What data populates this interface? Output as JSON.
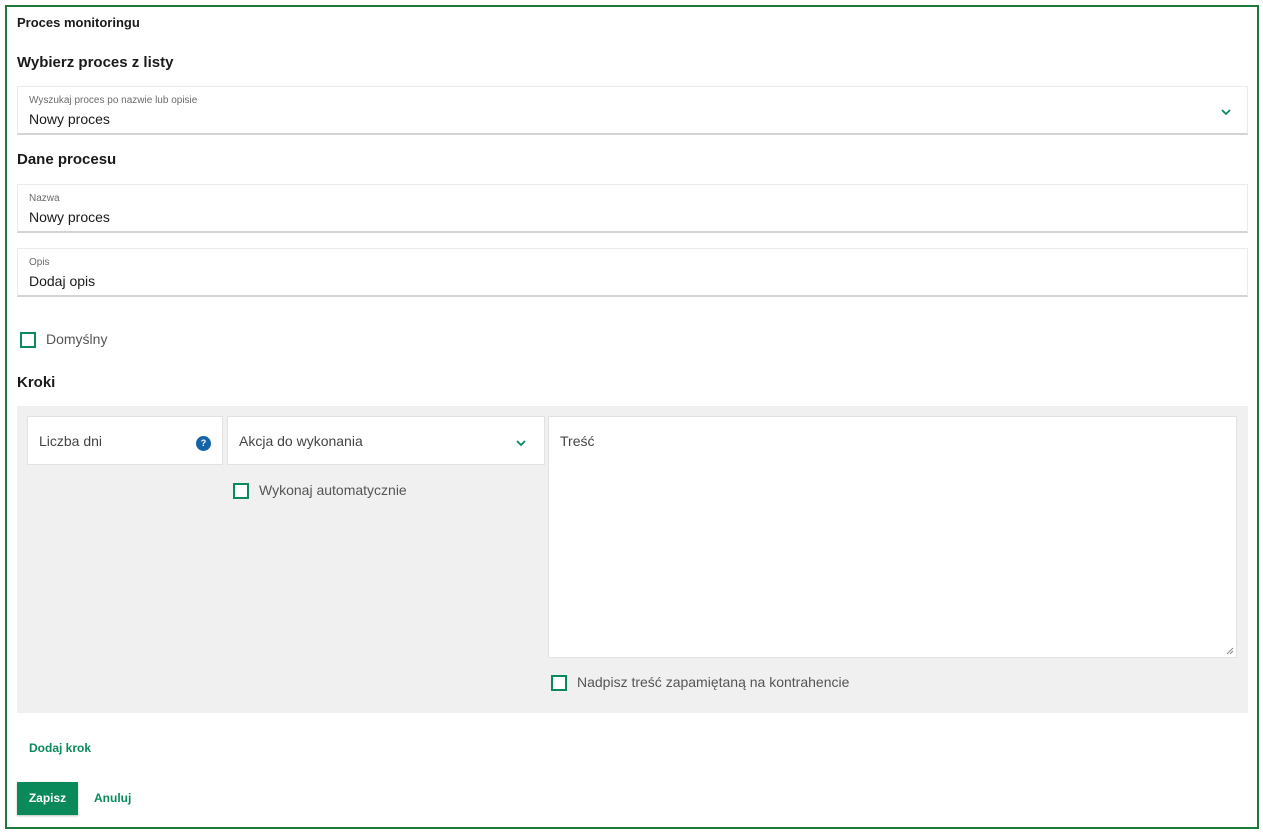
{
  "page": {
    "title": "Proces monitoringu"
  },
  "select_process": {
    "heading": "Wybierz proces z listy",
    "label": "Wyszukaj proces po nazwie lub opisie",
    "value": "Nowy proces"
  },
  "process_data": {
    "heading": "Dane procesu",
    "name_label": "Nazwa",
    "name_value": "Nowy proces",
    "description_label": "Opis",
    "description_value": "Dodaj opis",
    "default_label": "Domyślny"
  },
  "steps": {
    "heading": "Kroki",
    "days_label": "Liczba dni",
    "help_glyph": "?",
    "action_label": "Akcja do wykonania",
    "auto_label": "Wykonaj automatycznie",
    "content_label": "Treść",
    "overwrite_label": "Nadpisz treść zapamiętaną na kontrahencie"
  },
  "actions": {
    "add_step": "Dodaj krok",
    "save": "Zapisz",
    "cancel": "Anuluj"
  },
  "colors": {
    "accent": "#0a8a5a",
    "frame": "#1e7a3c",
    "help": "#1364a8"
  },
  "icons": [
    "chevron-down-icon",
    "help-icon",
    "resize-handle-icon"
  ]
}
